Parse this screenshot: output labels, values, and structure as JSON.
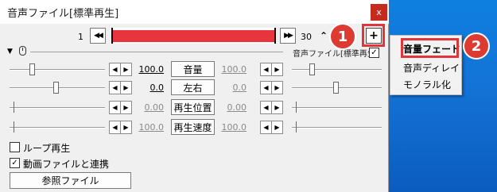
{
  "window": {
    "title": "音声ファイル[標準再生]",
    "close_label": "x"
  },
  "frame": {
    "start": "1",
    "end": "30",
    "rewind_label": "◀◀",
    "forward_label": "▶▶",
    "plus_label": "+"
  },
  "header": {
    "collapse_label": "▼",
    "filter_name": "音声ファイル[標準再生]",
    "filter_checked": "✓"
  },
  "params": [
    {
      "label": "音量",
      "value": "100.0",
      "right": "100.0"
    },
    {
      "label": "左右",
      "value": "0.0",
      "right": "0.0"
    },
    {
      "label": "再生位置",
      "value": "0.00",
      "right": "0.00"
    },
    {
      "label": "再生速度",
      "value": "100.0",
      "right": "100.0"
    }
  ],
  "stepper": {
    "left": "◀",
    "right": "▶"
  },
  "options": {
    "loop_label": "ループ再生",
    "loop_checked": "",
    "link_label": "動画ファイルと連携",
    "link_checked": "✓",
    "ref_button": "参照ファイル"
  },
  "menu": {
    "items": [
      "音量フェード",
      "音声ディレイ",
      "モノラル化"
    ]
  },
  "annotations": {
    "badge1": "1",
    "badge2": "2"
  }
}
